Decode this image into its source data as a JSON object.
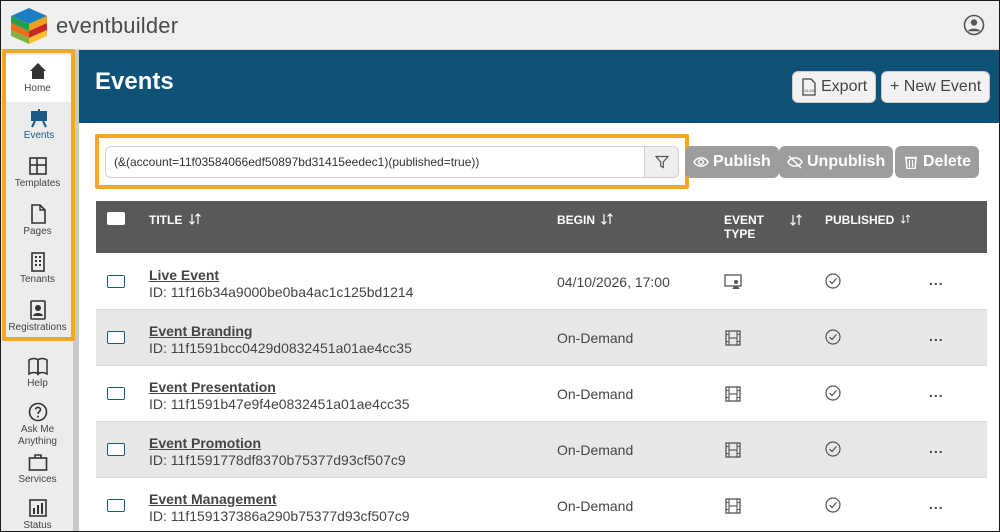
{
  "app": {
    "brand": "eventbuilder"
  },
  "sidebar": {
    "items": [
      {
        "label": "Home",
        "icon": "home-icon"
      },
      {
        "label": "Events",
        "icon": "easel-icon"
      },
      {
        "label": "Templates",
        "icon": "layout-icon"
      },
      {
        "label": "Pages",
        "icon": "page-icon"
      },
      {
        "label": "Tenants",
        "icon": "building-icon"
      },
      {
        "label": "Registrations",
        "icon": "id-badge-icon"
      },
      {
        "label": "Help",
        "icon": "book-icon"
      },
      {
        "label": "Ask Me Anything",
        "icon": "question-icon"
      },
      {
        "label": "Services",
        "icon": "briefcase-icon"
      },
      {
        "label": "Status",
        "icon": "status-icon"
      }
    ]
  },
  "header": {
    "title": "Events",
    "export_label": "Export",
    "new_event_label": "+ New Event"
  },
  "search": {
    "value": "(&(account=11f03584066edf50897bd31415eedec1)(published=true))"
  },
  "actions": {
    "publish_label": "Publish",
    "unpublish_label": "Unpublish",
    "delete_label": "Delete"
  },
  "table": {
    "columns": {
      "title": "TITLE",
      "begin": "BEGIN",
      "event_type_line1": "EVENT",
      "event_type_line2": "TYPE",
      "published": "PUBLISHED"
    },
    "rows": [
      {
        "title": "Live Event",
        "id": "ID: 11f16b34a9000be0ba4ac1c125bd1214",
        "begin": "04/10/2026, 17:00",
        "type": "live-presenter-icon",
        "more": "..."
      },
      {
        "title": "Event Branding",
        "id": "ID: 11f1591bcc0429d0832451a01ae4cc35",
        "begin": "On-Demand",
        "type": "film-icon",
        "more": "..."
      },
      {
        "title": "Event Presentation",
        "id": "ID: 11f1591b47e9f4e0832451a01ae4cc35",
        "begin": "On-Demand",
        "type": "film-icon",
        "more": "..."
      },
      {
        "title": "Event Promotion",
        "id": "ID: 11f1591778df8370b75377d93cf507c9",
        "begin": "On-Demand",
        "type": "film-icon",
        "more": "..."
      },
      {
        "title": "Event Management",
        "id": "ID: 11f159137386a290b75377d93cf507c9",
        "begin": "On-Demand",
        "type": "film-icon",
        "more": "..."
      }
    ]
  },
  "colors": {
    "header_bg": "#0e5277",
    "highlight": "#f5a623",
    "table_header_bg": "#595959",
    "action_button_bg": "#9d9d9d"
  }
}
